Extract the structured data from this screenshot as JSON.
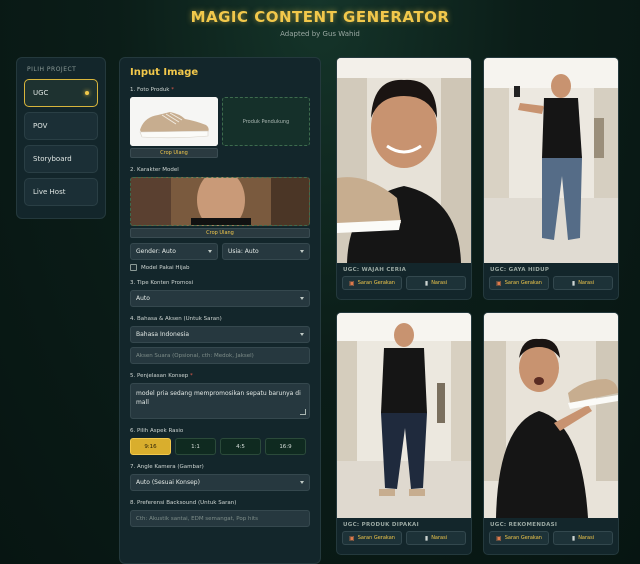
{
  "header": {
    "title": "MAGIC CONTENT GENERATOR",
    "subtitle": "Adapted by Gus Wahid"
  },
  "modes": {
    "heading": "PILIH PROJECT",
    "items": [
      "UGC",
      "POV",
      "Storyboard",
      "Live Host"
    ],
    "active": "UGC"
  },
  "form": {
    "title": "Input Image",
    "product_label": "1. Foto Produk",
    "support_product": "Produk Pendukung",
    "crop_again": "Crop Ulang",
    "character_label": "2. Karakter Model",
    "gender": "Gender: Auto",
    "age": "Usia: Auto",
    "hijab_label": "Model Pakai Hijab",
    "promo_type_label": "3. Tipe Konten Promosi",
    "promo_type_value": "Auto",
    "language_label": "4. Bahasa & Aksen (Untuk Saran)",
    "language_value": "Bahasa Indonesia",
    "voice_placeholder": "Aksen Suara (Opsional, cth: Medok, Jaksel)",
    "concept_label": "5. Penjelasan Konsep",
    "concept_value": "model pria sedang mempromosikan sepatu barunya di mall",
    "ratio_label": "6. Pilih Aspek Rasio",
    "ratios": [
      "9:16",
      "1:1",
      "4:5",
      "16:9"
    ],
    "ratio_active": "9:16",
    "camera_label": "7. Angle Kamera (Gambar)",
    "camera_value": "Auto (Sesuai Konsep)",
    "backsound_label": "8. Preferensi Backsound (Untuk Saran)",
    "backsound_placeholder": "Cth: Akustik santai, EDM semangat, Pop hits"
  },
  "results": [
    {
      "label": "UGC: WAJAH CERIA",
      "btn1": "Saran Gerakan",
      "btn2": "Narasi"
    },
    {
      "label": "UGC: GAYA HIDUP",
      "btn1": "Saran Gerakan",
      "btn2": "Narasi"
    },
    {
      "label": "UGC: PRODUK DIPAKAI",
      "btn1": "Saran Gerakan",
      "btn2": "Narasi"
    },
    {
      "label": "UGC: REKOMENDASI",
      "btn1": "Saran Gerakan",
      "btn2": "Narasi"
    }
  ],
  "colors": {
    "accent": "#f2c84b",
    "background": "#0b1d18",
    "panel": "#13262b"
  }
}
